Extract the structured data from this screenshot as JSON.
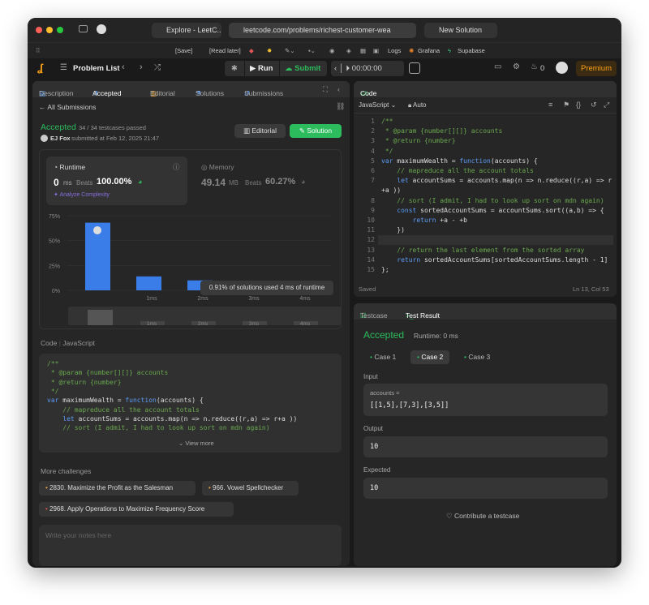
{
  "browser": {
    "tabs": [
      {
        "label": "Explore - LeetC..."
      },
      {
        "label": "leetcode.com/problems/richest-customer-wea"
      },
      {
        "label": "New Solution"
      }
    ],
    "bookmarks": [
      "[Save]",
      "[Read later]",
      "Logs",
      "Grafana",
      "Supabase"
    ]
  },
  "header": {
    "problem_list": "Problem List",
    "run": "Run",
    "submit": "Submit",
    "timer": "00:00:00",
    "notif_count": "0",
    "premium": "Premium"
  },
  "left": {
    "tabs": {
      "description": "Description",
      "accepted": "Accepted",
      "editorial": "Editorial",
      "solutions": "Solutions",
      "submissions": "Submissions"
    },
    "all_submissions": "All Submissions",
    "status": "Accepted",
    "testcases": "34 / 34 testcases passed",
    "author": "EJ Fox",
    "submitted": "submitted at Feb 12, 2025 21:47",
    "editorial_btn": "Editorial",
    "solution_btn": "Solution",
    "runtime": {
      "label": "Runtime",
      "value": "0",
      "unit": "ms",
      "beats_label": "Beats",
      "beats": "100.00%",
      "analyze": "Analyze Complexity"
    },
    "memory": {
      "label": "Memory",
      "value": "49.14",
      "unit": "MB",
      "beats_label": "Beats",
      "beats": "60.27%"
    },
    "tooltip": "0.91% of solutions used 4 ms of runtime",
    "code_label": "Code",
    "code_lang": "JavaScript",
    "code_preview": [
      "/**",
      " * @param {number[][]} accounts",
      " * @return {number}",
      " */",
      "var maximumWealth = function(accounts) {",
      "    // mapreduce all the account totals",
      "    let accountSums = accounts.map(n => n.reduce((r,a) => r+a ))",
      "    // sort (I admit, I had to look up sort on mdn again)"
    ],
    "view_more": "View more",
    "more_challenges": "More challenges",
    "challenges": [
      {
        "label": "2830. Maximize the Profit as the Salesman",
        "color": "#e8a33a"
      },
      {
        "label": "966. Vowel Spellchecker",
        "color": "#e8a33a"
      },
      {
        "label": "2968. Apply Operations to Maximize Frequency Score",
        "color": "#e05555"
      }
    ],
    "notes_placeholder": "Write your notes here"
  },
  "chart_data": {
    "type": "bar",
    "ylabels": [
      "75%",
      "50%",
      "25%",
      "0%"
    ],
    "ylim": [
      0,
      75
    ],
    "categories": [
      "0ms",
      "1ms",
      "2ms",
      "3ms",
      "4ms"
    ],
    "xlabels": [
      "1ms",
      "2ms",
      "3ms",
      "4ms"
    ],
    "values": [
      68,
      14,
      10,
      2.5,
      2.5
    ]
  },
  "editor": {
    "title": "Code",
    "lang": "JavaScript",
    "auto": "Auto",
    "status": "Saved",
    "position": "Ln 13, Col 53"
  },
  "testpanel": {
    "tab_testcase": "Testcase",
    "tab_result": "Test Result",
    "status": "Accepted",
    "runtime": "Runtime: 0 ms",
    "cases": [
      "Case 1",
      "Case 2",
      "Case 3"
    ],
    "input_label": "Input",
    "input_name": "accounts =",
    "input_value": "[[1,5],[7,3],[3,5]]",
    "output_label": "Output",
    "output_value": "10",
    "expected_label": "Expected",
    "expected_value": "10",
    "contribute": "Contribute a testcase"
  },
  "colors": {
    "accent_green": "#2cbb5d",
    "accent_orange": "#ffa116",
    "bar_blue": "#3a7de8"
  }
}
